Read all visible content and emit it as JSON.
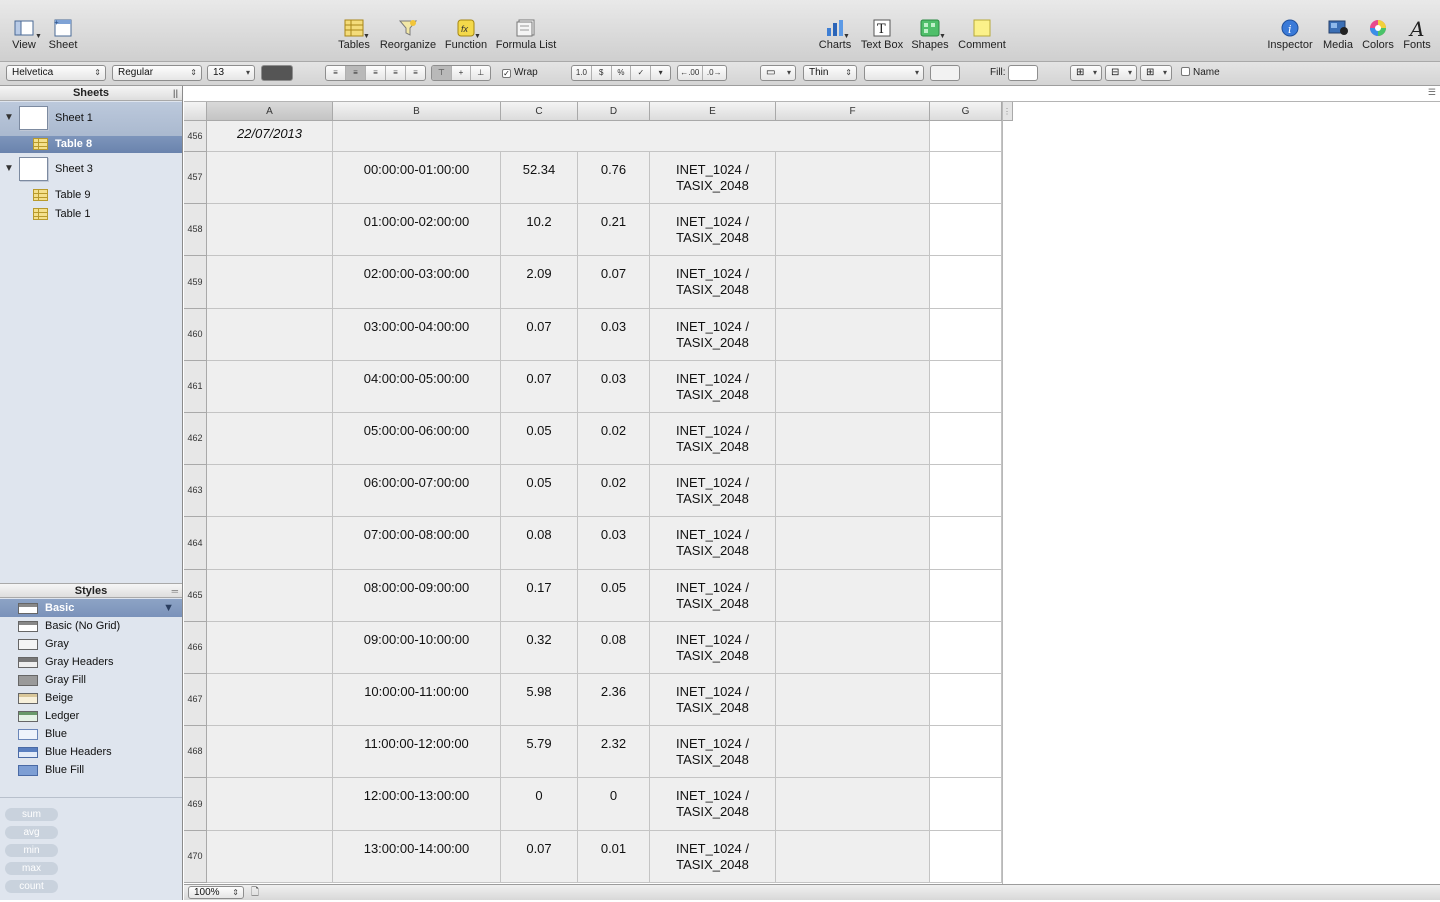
{
  "toolbar": {
    "view": "View",
    "sheet": "Sheet",
    "tables": "Tables",
    "reorganize": "Reorganize",
    "function": "Function",
    "formula_list": "Formula List",
    "charts": "Charts",
    "text_box": "Text Box",
    "shapes": "Shapes",
    "comment": "Comment",
    "inspector": "Inspector",
    "media": "Media",
    "colors": "Colors",
    "fonts": "Fonts"
  },
  "format_bar": {
    "font_family": "Helvetica",
    "font_style": "Regular",
    "font_size": "13",
    "wrap_label": "Wrap",
    "border_weight": "Thin",
    "fill_label": "Fill:",
    "name_label": "Name",
    "number_buttons": [
      "1.0",
      "$",
      "%",
      "✓",
      "▾"
    ],
    "decimal_buttons": [
      "←.00",
      ".0→"
    ]
  },
  "sidebar": {
    "sheets_header": "Sheets",
    "sheets": [
      {
        "name": "Sheet 1",
        "tables": [
          "Table 8"
        ]
      },
      {
        "name": "Sheet 3",
        "tables": [
          "Table 9",
          "Table 1"
        ]
      }
    ],
    "styles_header": "Styles",
    "styles": [
      "Basic",
      "Basic (No Grid)",
      "Gray",
      "Gray Headers",
      "Gray Fill",
      "Beige",
      "Ledger",
      "Blue",
      "Blue Headers",
      "Blue Fill"
    ],
    "quick_calc": [
      "sum",
      "avg",
      "min",
      "max",
      "count"
    ]
  },
  "grid": {
    "columns": [
      "A",
      "B",
      "C",
      "D",
      "E",
      "F",
      "G"
    ],
    "date_row": {
      "num": "456",
      "value": "22/07/2013"
    },
    "rows": [
      {
        "num": "457",
        "b": "00:00:00-01:00:00",
        "c": "52.34",
        "d": "0.76",
        "e1": "INET_1024 /",
        "e2": "TASIX_2048"
      },
      {
        "num": "458",
        "b": "01:00:00-02:00:00",
        "c": "10.2",
        "d": "0.21",
        "e1": "INET_1024 /",
        "e2": "TASIX_2048"
      },
      {
        "num": "459",
        "b": "02:00:00-03:00:00",
        "c": "2.09",
        "d": "0.07",
        "e1": "INET_1024 /",
        "e2": "TASIX_2048"
      },
      {
        "num": "460",
        "b": "03:00:00-04:00:00",
        "c": "0.07",
        "d": "0.03",
        "e1": "INET_1024 /",
        "e2": "TASIX_2048"
      },
      {
        "num": "461",
        "b": "04:00:00-05:00:00",
        "c": "0.07",
        "d": "0.03",
        "e1": "INET_1024 /",
        "e2": "TASIX_2048"
      },
      {
        "num": "462",
        "b": "05:00:00-06:00:00",
        "c": "0.05",
        "d": "0.02",
        "e1": "INET_1024 /",
        "e2": "TASIX_2048"
      },
      {
        "num": "463",
        "b": "06:00:00-07:00:00",
        "c": "0.05",
        "d": "0.02",
        "e1": "INET_1024 /",
        "e2": "TASIX_2048"
      },
      {
        "num": "464",
        "b": "07:00:00-08:00:00",
        "c": "0.08",
        "d": "0.03",
        "e1": "INET_1024 /",
        "e2": "TASIX_2048"
      },
      {
        "num": "465",
        "b": "08:00:00-09:00:00",
        "c": "0.17",
        "d": "0.05",
        "e1": "INET_1024 /",
        "e2": "TASIX_2048"
      },
      {
        "num": "466",
        "b": "09:00:00-10:00:00",
        "c": "0.32",
        "d": "0.08",
        "e1": "INET_1024 /",
        "e2": "TASIX_2048"
      },
      {
        "num": "467",
        "b": "10:00:00-11:00:00",
        "c": "5.98",
        "d": "2.36",
        "e1": "INET_1024 /",
        "e2": "TASIX_2048"
      },
      {
        "num": "468",
        "b": "11:00:00-12:00:00",
        "c": "5.79",
        "d": "2.32",
        "e1": "INET_1024 /",
        "e2": "TASIX_2048"
      },
      {
        "num": "469",
        "b": "12:00:00-13:00:00",
        "c": "0",
        "d": "0",
        "e1": "INET_1024 /",
        "e2": "TASIX_2048"
      },
      {
        "num": "470",
        "b": "13:00:00-14:00:00",
        "c": "0.07",
        "d": "0.01",
        "e1": "INET_1024 /",
        "e2": "TASIX_2048"
      }
    ]
  },
  "status": {
    "zoom": "100%"
  }
}
